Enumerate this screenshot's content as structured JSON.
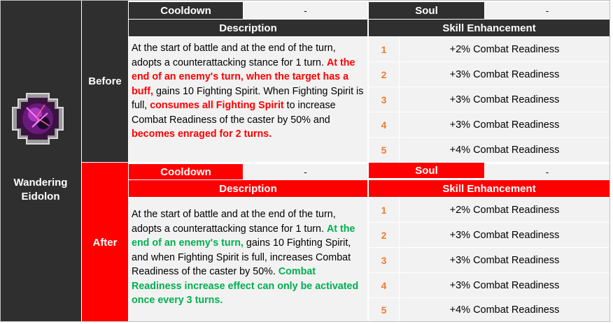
{
  "skill": {
    "name": "Wandering Eidolon",
    "name_line1": "Wandering",
    "name_line2": "Eidolon",
    "icon": "wandering-eidolon-skill-icon"
  },
  "labels": {
    "cooldown": "Cooldown",
    "soul": "Soul",
    "description": "Description",
    "skill_enhancement": "Skill Enhancement"
  },
  "before": {
    "label": "Before",
    "cooldown_value": "-",
    "soul_value": "-",
    "description": [
      {
        "text": "At the start of battle and at the end of the turn, adopts a counterattacking stance for 1 turn. ",
        "style": "normal"
      },
      {
        "text": "At the end of an enemy's turn, when the target has a buff,",
        "style": "red"
      },
      {
        "text": " gains 10 Fighting Spirit. When Fighting Spirit is full, ",
        "style": "normal"
      },
      {
        "text": "consumes all Fighting Spirit",
        "style": "red"
      },
      {
        "text": " to increase Combat Readiness of the caster by 50% and ",
        "style": "normal"
      },
      {
        "text": "becomes enraged for 2 turns.",
        "style": "red"
      }
    ],
    "enhancements": [
      {
        "level": "1",
        "text": "+2% Combat Readiness"
      },
      {
        "level": "2",
        "text": "+3% Combat Readiness"
      },
      {
        "level": "3",
        "text": "+3% Combat Readiness"
      },
      {
        "level": "4",
        "text": "+3% Combat Readiness"
      },
      {
        "level": "5",
        "text": "+4% Combat Readiness"
      }
    ]
  },
  "after": {
    "label": "After",
    "cooldown_value": "-",
    "soul_value": "-",
    "description": [
      {
        "text": "At the start of battle and at the end of the turn, adopts a counterattacking stance for 1 turn. ",
        "style": "normal"
      },
      {
        "text": "At the end of an enemy's turn,",
        "style": "green"
      },
      {
        "text": " gains 10 Fighting Spirit, and when Fighting Spirit is full, increases Combat Readiness of the caster by 50%. ",
        "style": "normal"
      },
      {
        "text": "Combat Readiness increase effect can only be activated once every 3 turns.",
        "style": "green"
      }
    ],
    "enhancements": [
      {
        "level": "1",
        "text": "+2% Combat Readiness"
      },
      {
        "level": "2",
        "text": "+3% Combat Readiness"
      },
      {
        "level": "3",
        "text": "+3% Combat Readiness"
      },
      {
        "level": "4",
        "text": "+3% Combat Readiness"
      },
      {
        "level": "5",
        "text": "+4% Combat Readiness"
      }
    ]
  },
  "colors": {
    "before_header_bg": "#2f2f2f",
    "after_header_bg": "#ff0000",
    "highlight_before": "#ff0000",
    "highlight_after": "#00b050",
    "level_number": "#ed7d31"
  }
}
